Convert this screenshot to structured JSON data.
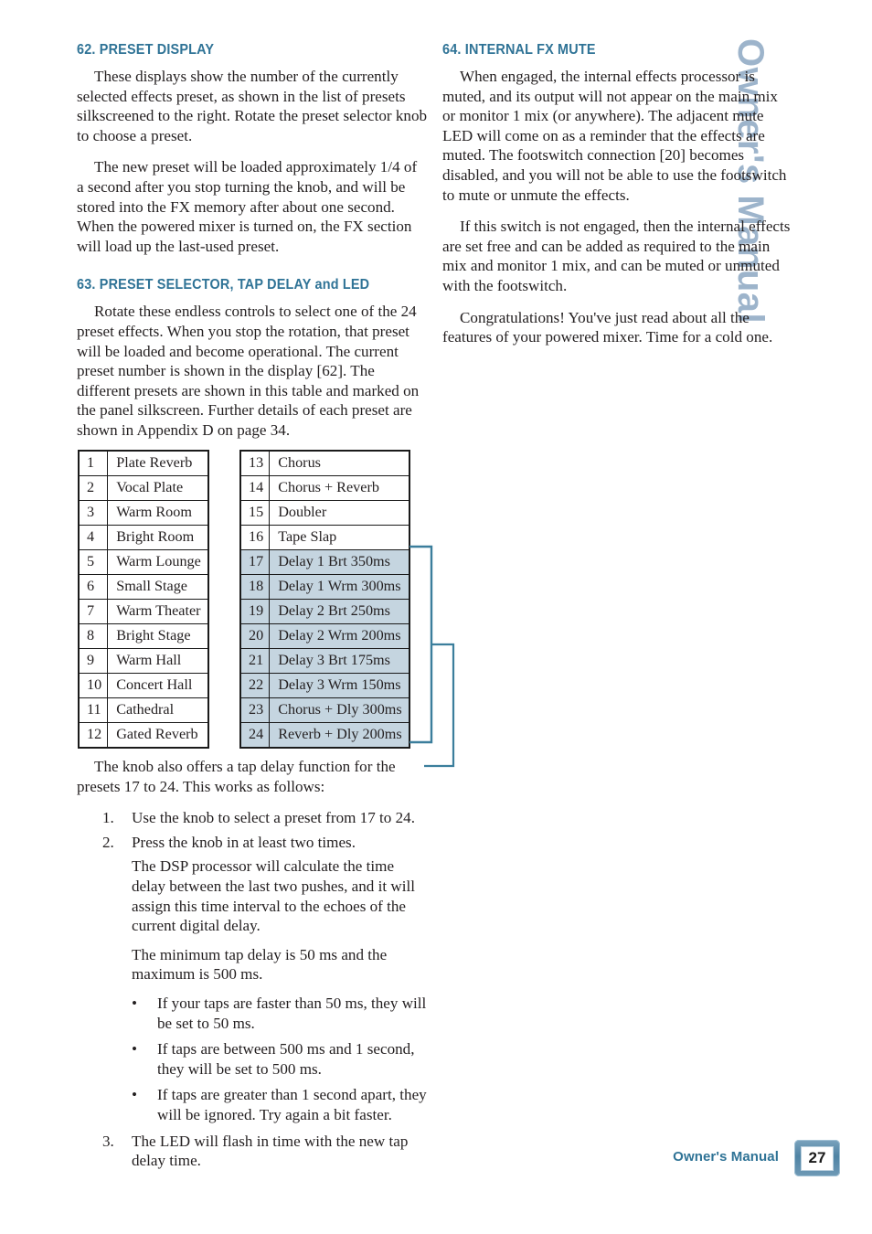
{
  "side_title": "Owner's Manual",
  "left_column": {
    "section_62": {
      "heading": "62. PRESET DISPLAY",
      "paragraphs": [
        "These displays show the number of the currently selected effects preset, as shown in the list of presets silkscreened to the right. Rotate the preset selector knob to choose a preset.",
        "The new preset will be loaded approximately 1/4 of a second after you stop turning the knob, and will be stored into the FX memory after about one second. When the powered mixer is turned on, the FX section will load up the last-used preset."
      ]
    },
    "section_63": {
      "heading": "63. PRESET SELECTOR, TAP DELAY and LED",
      "paragraphs": [
        "Rotate these endless controls to select one of the 24 preset effects. When you stop the rotation, that preset will be loaded and become operational. The current preset number is shown in the display [62]. The different presets are shown in this table and marked on the panel silkscreen. Further details of each preset are shown in Appendix D on page 34."
      ]
    },
    "intro_after_table": "The knob also offers a tap delay function for the presets 17 to 24. This works as follows:",
    "steps": [
      {
        "marker": "1.",
        "text": "Use the knob to select a preset from 17 to 24."
      },
      {
        "marker": "2.",
        "text": "Press the knob in at least two times."
      }
    ],
    "step2_notes": [
      "The DSP processor will calculate the time delay between the last two pushes, and it will assign this time interval to the echoes of the current digital delay.",
      "The minimum tap delay is 50 ms and the maximum is 500 ms."
    ],
    "bullets": [
      "If your taps are faster than 50 ms, they will be set to 50 ms.",
      "If taps are between 500 ms and 1 second, they will be set to 500 ms.",
      "If taps are greater than 1 second apart, they will be ignored. Try again a bit faster."
    ],
    "step3": {
      "marker": "3.",
      "text": "The LED will flash in time with the new tap delay time."
    }
  },
  "right_column": {
    "section_64": {
      "heading": "64. INTERNAL FX MUTE",
      "paragraphs": [
        "When engaged, the internal effects processor is muted, and its output will not appear on the main mix or monitor 1 mix (or anywhere). The adjacent mute LED will come on as a reminder that the effects are muted. The footswitch connection [20] becomes disabled, and you will not be able to use the footswitch to mute or unmute the effects.",
        "If this switch is not engaged, then the internal effects are set free and can be added as required to the main mix and monitor 1 mix, and can be muted or unmuted with the footswitch.",
        "Congratulations! You've just read about all the features of your powered mixer. Time for a cold one."
      ]
    }
  },
  "preset_table": {
    "left": [
      {
        "num": "1",
        "name": "Plate Reverb",
        "highlight": false
      },
      {
        "num": "2",
        "name": "Vocal Plate",
        "highlight": false
      },
      {
        "num": "3",
        "name": "Warm Room",
        "highlight": false
      },
      {
        "num": "4",
        "name": "Bright Room",
        "highlight": false
      },
      {
        "num": "5",
        "name": "Warm Lounge",
        "highlight": false
      },
      {
        "num": "6",
        "name": "Small Stage",
        "highlight": false
      },
      {
        "num": "7",
        "name": "Warm Theater",
        "highlight": false
      },
      {
        "num": "8",
        "name": "Bright Stage",
        "highlight": false
      },
      {
        "num": "9",
        "name": "Warm Hall",
        "highlight": false
      },
      {
        "num": "10",
        "name": "Concert Hall",
        "highlight": false
      },
      {
        "num": "11",
        "name": "Cathedral",
        "highlight": false
      },
      {
        "num": "12",
        "name": "Gated Reverb",
        "highlight": false
      }
    ],
    "right": [
      {
        "num": "13",
        "name": "Chorus",
        "highlight": false
      },
      {
        "num": "14",
        "name": "Chorus + Reverb",
        "highlight": false
      },
      {
        "num": "15",
        "name": "Doubler",
        "highlight": false
      },
      {
        "num": "16",
        "name": "Tape Slap",
        "highlight": false
      },
      {
        "num": "17",
        "name": "Delay 1 Brt 350ms",
        "highlight": true
      },
      {
        "num": "18",
        "name": "Delay 1 Wrm 300ms",
        "highlight": true
      },
      {
        "num": "19",
        "name": "Delay 2 Brt 250ms",
        "highlight": true
      },
      {
        "num": "20",
        "name": "Delay 2 Wrm 200ms",
        "highlight": true
      },
      {
        "num": "21",
        "name": "Delay 3 Brt 175ms",
        "highlight": true
      },
      {
        "num": "22",
        "name": "Delay 3 Wrm 150ms",
        "highlight": true
      },
      {
        "num": "23",
        "name": "Chorus + Dly 300ms",
        "highlight": true
      },
      {
        "num": "24",
        "name": "Reverb + Dly 200ms",
        "highlight": true
      }
    ],
    "highlight_color": "#c5d5e0",
    "bracket_color": "#3b7e9c"
  },
  "footer": {
    "label": "Owner's Manual",
    "page_number": "27"
  }
}
